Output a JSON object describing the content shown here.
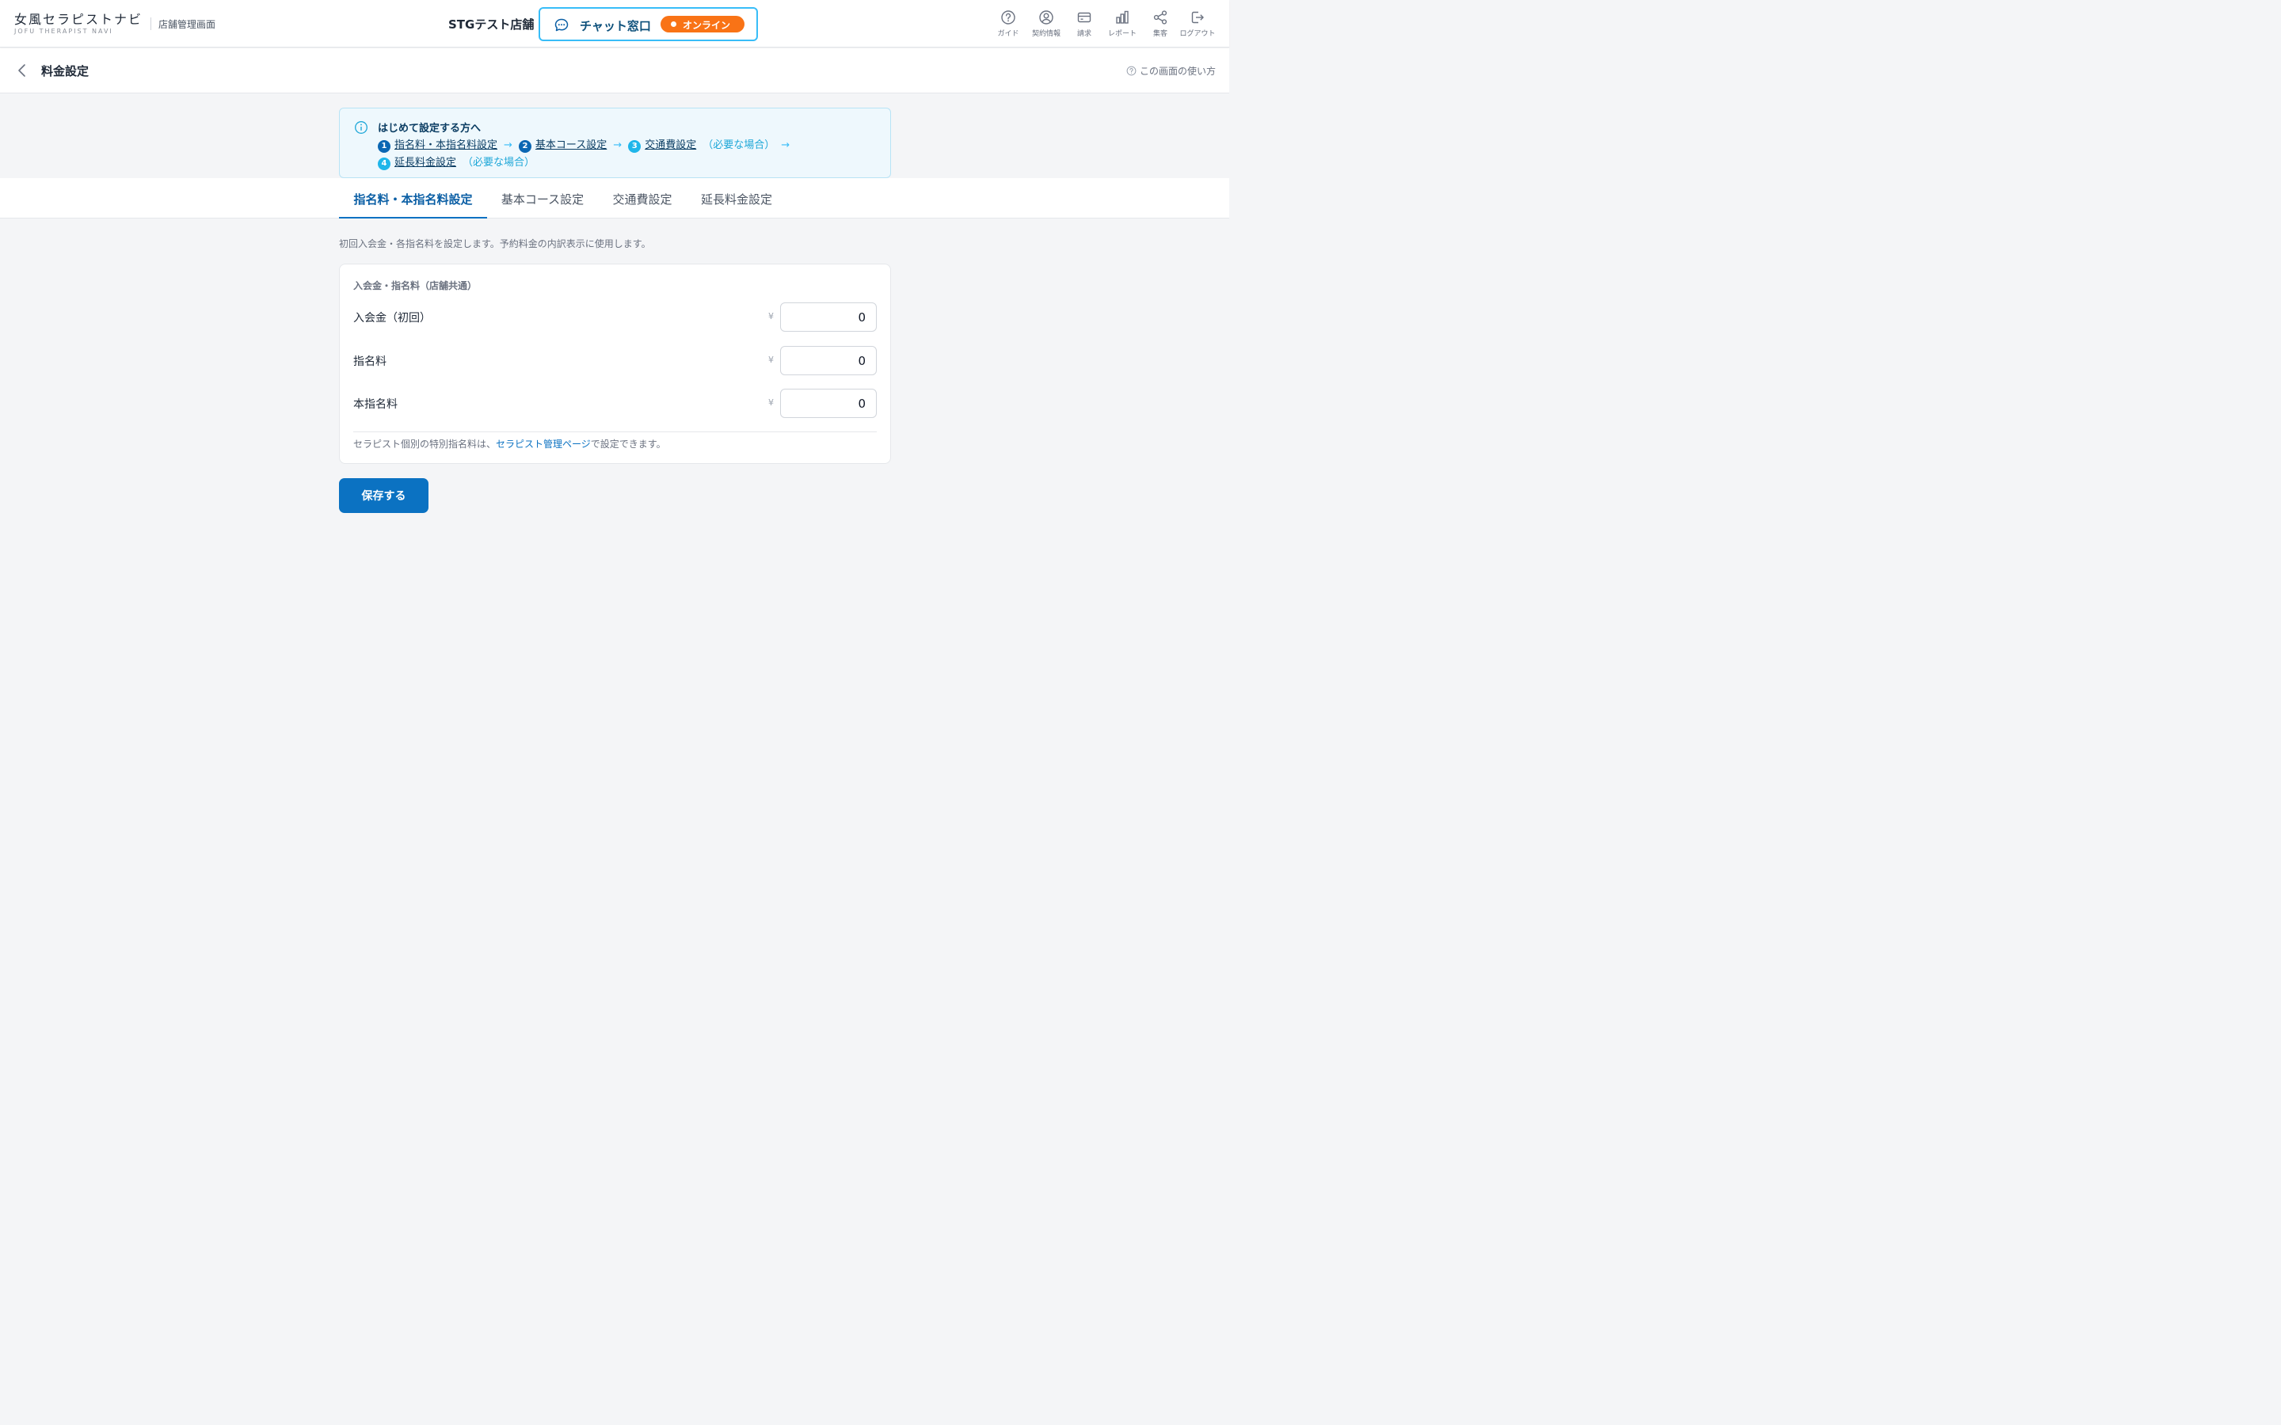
{
  "header": {
    "logo_main": "女風セラピストナビ",
    "logo_sub": "JOFU THERAPIST NAVI",
    "admin_label": "店舗管理画面",
    "store_name": "STGテスト店舗",
    "chat": {
      "label": "チャット窓口",
      "status": "オンライン",
      "status_color": "#f97316",
      "border_color": "#38bdf8"
    },
    "nav": [
      {
        "label": "ガイド",
        "icon": "help-circle-icon"
      },
      {
        "label": "契約情報",
        "icon": "user-circle-icon"
      },
      {
        "label": "請求",
        "icon": "credit-card-icon"
      },
      {
        "label": "レポート",
        "icon": "bar-chart-icon"
      },
      {
        "label": "集客",
        "icon": "share-icon"
      },
      {
        "label": "ログアウト",
        "icon": "logout-icon"
      }
    ]
  },
  "subheader": {
    "title": "料金設定",
    "help_link": "この画面の使い方"
  },
  "guide": {
    "title": "はじめて設定する方へ",
    "steps": [
      {
        "num": "1",
        "label": "指名料・本指名料設定",
        "note": ""
      },
      {
        "num": "2",
        "label": "基本コース設定",
        "note": ""
      },
      {
        "num": "3",
        "label": "交通費設定",
        "note": "（必要な場合）"
      },
      {
        "num": "4",
        "label": "延長料金設定",
        "note": "（必要な場合）"
      }
    ],
    "arrow": "→"
  },
  "tabs": [
    {
      "label": "指名料・本指名料設定",
      "active": true
    },
    {
      "label": "基本コース設定",
      "active": false
    },
    {
      "label": "交通費設定",
      "active": false
    },
    {
      "label": "延長料金設定",
      "active": false
    }
  ],
  "content": {
    "description": "初回入会金・各指名料を設定します。予約料金の内訳表示に使用します。",
    "section_title": "入会金・指名料（店舗共通）",
    "currency": "¥",
    "fees": [
      {
        "label": "入会金（初回）",
        "value": "0"
      },
      {
        "label": "指名料",
        "value": "0"
      },
      {
        "label": "本指名料",
        "value": "0"
      }
    ],
    "note_prefix": "セラピスト個別の特別指名料は、",
    "note_link": "セラピスト管理ページ",
    "note_suffix": "で設定できます。",
    "save_label": "保存する",
    "accent_color": "#0b72c2"
  }
}
